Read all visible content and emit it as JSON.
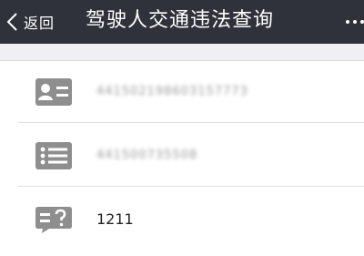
{
  "navbar": {
    "back_label": "返回",
    "title": "驾驶人交通违法查询"
  },
  "form": {
    "license_number": "441502198603157773",
    "file_number": "441500735508",
    "verification_code": "1211"
  },
  "colors": {
    "navbar_bg": "#2f323a",
    "icon_color": "#8e8e8e",
    "page_bg": "#efeff4"
  },
  "icons": [
    "chevron-left-icon",
    "more-icon",
    "id-card-icon",
    "list-icon",
    "verify-code-icon"
  ]
}
